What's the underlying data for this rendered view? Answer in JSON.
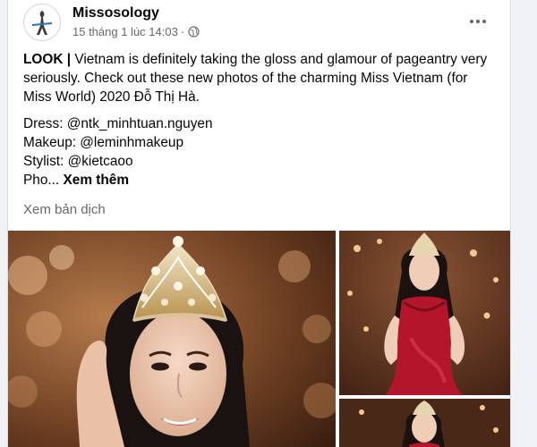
{
  "post": {
    "page_name": "Missosology",
    "timestamp": "15 tháng 1 lúc 14:03",
    "separator": "·",
    "privacy_icon": "globe-icon",
    "more_icon": "more-horizontal-icon",
    "text": {
      "lead": "LOOK",
      "divider": " | ",
      "body": "Vietnam is definitely taking the gloss and glamour of pageantry very seriously. Check out these new photos of the charming Miss Vietnam (for Miss World) 2020 Đỗ Thị Hà.",
      "credits": [
        "Dress: @ntk_minhtuan.nguyen",
        "Makeup: @leminhmakeup",
        "Stylist: @kietcaoo"
      ],
      "truncated": "Pho...",
      "see_more": "Xem thêm"
    },
    "see_translation": "Xem bản dịch",
    "photos": [
      {
        "kind": "portrait-closeup-with-crown"
      },
      {
        "kind": "red-gown-full-body"
      },
      {
        "kind": "red-gown-partial"
      }
    ]
  },
  "colors": {
    "background": "#f0f2f5",
    "card": "#ffffff",
    "primary_text": "#050505",
    "secondary_text": "#65676b"
  }
}
